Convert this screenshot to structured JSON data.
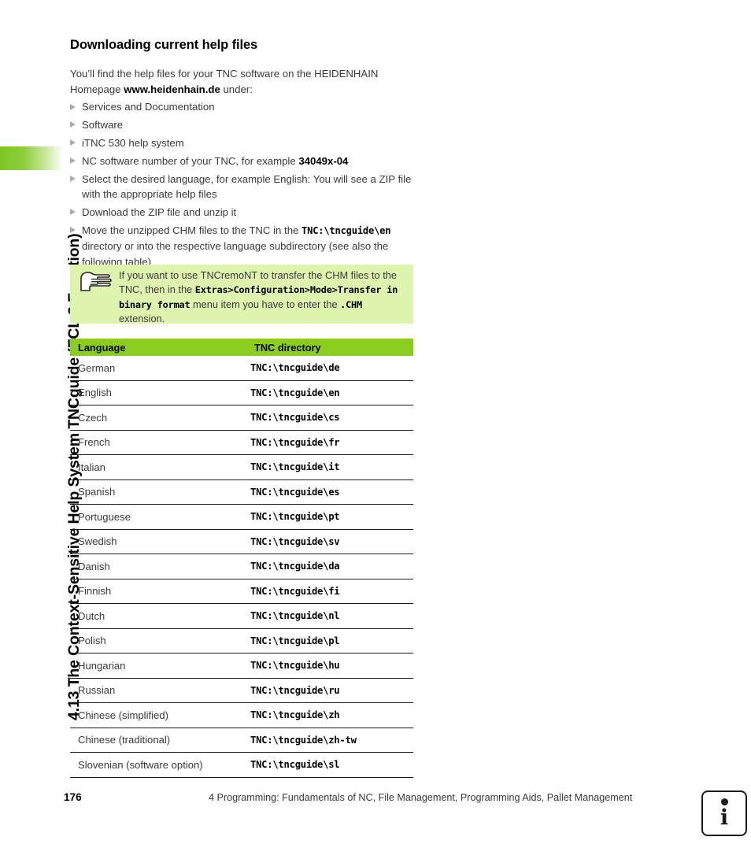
{
  "sidebar": {
    "chapter_title": "4.13 The Context-Sensitive Help System TNCguide (FCL 3 Function)",
    "tab_color": "#7DC623"
  },
  "page": {
    "heading": "Downloading current help files",
    "intro": {
      "line_1": "You’ll find the help files for your TNC software on the HEIDENHAIN",
      "line_2_prefix": "Homepage ",
      "line_2_bold": "www.heidenhain.de",
      "line_2_suffix": " under:"
    },
    "steps": [
      {
        "text": "Services and Documentation"
      },
      {
        "text": "Software"
      },
      {
        "text": "iTNC 530 help system"
      },
      {
        "text": "NC software number of your TNC, for example ",
        "bold": "34049x-04"
      },
      {
        "text": "Select the desired language, for example English: You will see a ZIP file with the appropriate help files"
      },
      {
        "text": "Download the ZIP file and unzip it"
      },
      {
        "text": "Move the unzipped CHM files to the TNC in the ",
        "mono": "TNC:\\tncguide\\en",
        "text_after": " directory or into the respective language subdirectory (see also the following table)"
      }
    ],
    "note": {
      "icon": "pointing-hand-icon",
      "background": "#DEF3AE",
      "part_1": "If you want to use TNCremoNT to transfer the CHM files to the TNC, then in the ",
      "mono_1": "Extras>Configuration>Mode>",
      "mono_2": "Transfer in binary format",
      "part_2": " menu item you have to enter the ",
      "mono_3": ".CHM",
      "part_3": " extension."
    },
    "table": {
      "header_color": "#8ACD1E",
      "columns": [
        "Language",
        "TNC directory"
      ],
      "rows": [
        [
          "German",
          "TNC:\\tncguide\\de"
        ],
        [
          "English",
          "TNC:\\tncguide\\en"
        ],
        [
          "Czech",
          "TNC:\\tncguide\\cs"
        ],
        [
          "French",
          "TNC:\\tncguide\\fr"
        ],
        [
          "Italian",
          "TNC:\\tncguide\\it"
        ],
        [
          "Spanish",
          "TNC:\\tncguide\\es"
        ],
        [
          "Portuguese",
          "TNC:\\tncguide\\pt"
        ],
        [
          "Swedish",
          "TNC:\\tncguide\\sv"
        ],
        [
          "Danish",
          "TNC:\\tncguide\\da"
        ],
        [
          "Finnish",
          "TNC:\\tncguide\\fi"
        ],
        [
          "Dutch",
          "TNC:\\tncguide\\nl"
        ],
        [
          "Polish",
          "TNC:\\tncguide\\pl"
        ],
        [
          "Hungarian",
          "TNC:\\tncguide\\hu"
        ],
        [
          "Russian",
          "TNC:\\tncguide\\ru"
        ],
        [
          "Chinese (simplified)",
          "TNC:\\tncguide\\zh"
        ],
        [
          "Chinese (traditional)",
          "TNC:\\tncguide\\zh-tw"
        ],
        [
          "Slovenian (software option)",
          "TNC:\\tncguide\\sl"
        ]
      ]
    },
    "footer": {
      "page_number": "176",
      "chapter_line": "4 Programming: Fundamentals of NC, File Management, Programming Aids, Pallet Management",
      "badge_letter": "i"
    }
  }
}
